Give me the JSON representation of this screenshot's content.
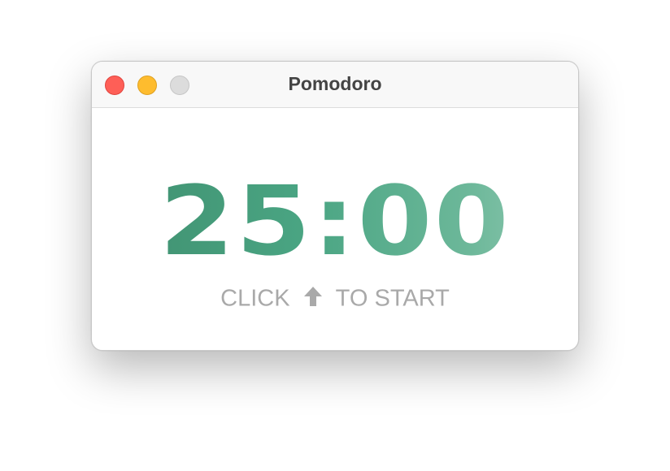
{
  "window": {
    "title": "Pomodoro"
  },
  "traffic_lights": {
    "close_color": "#fe5f57",
    "minimize_color": "#febc2e",
    "zoom_color": "#dcdcdc"
  },
  "timer": {
    "display": "25:00",
    "gradient_start": "#3d8b6b",
    "gradient_end": "#a3d1be"
  },
  "hint": {
    "prefix": "CLICK",
    "icon": "up-arrow-icon",
    "suffix": "TO START",
    "color": "#a9a9a9"
  }
}
